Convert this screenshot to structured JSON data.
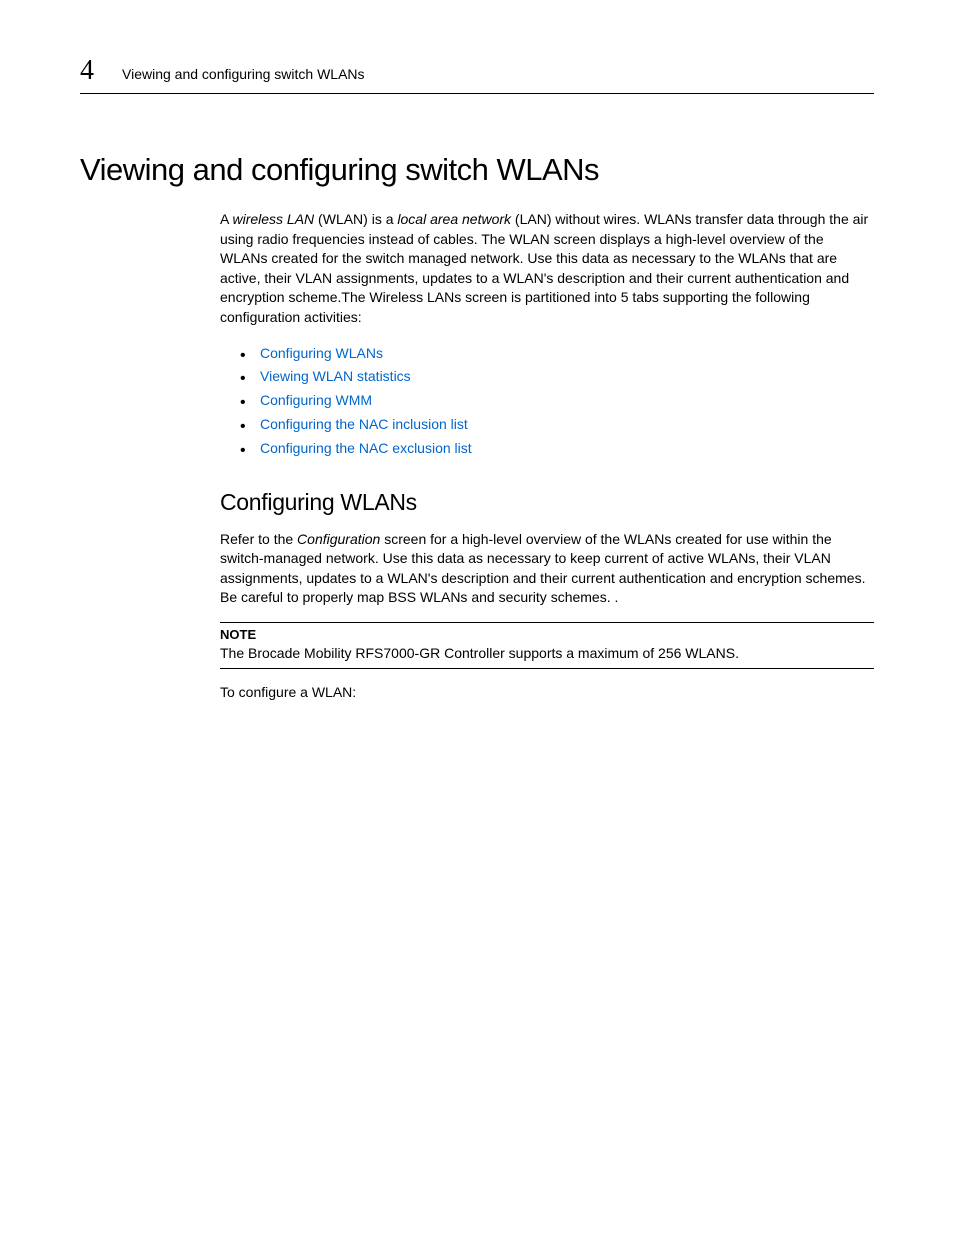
{
  "header": {
    "chapter_number": "4",
    "running_title": "Viewing and configuring switch WLANs"
  },
  "main_heading": "Viewing and configuring switch WLANs",
  "intro": {
    "seg1": "A ",
    "italic1": "wireless LAN",
    "seg2": " (WLAN) is a ",
    "italic2": "local area network",
    "seg3": " (LAN) without wires. WLANs transfer data through the air using radio frequencies instead of cables. The WLAN screen displays a high-level overview of the WLANs created for the switch managed network. Use this data as necessary to the WLANs that are active, their VLAN assignments, updates to a WLAN's description and their current authentication and encryption scheme.The Wireless LANs screen is partitioned into 5 tabs supporting the following configuration activities:"
  },
  "bullets": [
    "Configuring WLANs",
    "Viewing WLAN statistics",
    "Configuring WMM",
    "Configuring the NAC inclusion list",
    "Configuring the NAC exclusion list"
  ],
  "section": {
    "heading": "Configuring WLANs",
    "para_seg1": "Refer to the ",
    "para_italic": "Configuration",
    "para_seg2": " screen for a high-level overview of the WLANs created for use within the switch-managed network. Use this data as necessary to keep current of active WLANs, their VLAN assignments, updates to a WLAN's description and their current authentication and encryption schemes. Be careful to properly map BSS WLANs and security schemes. ."
  },
  "note": {
    "label": "NOTE",
    "text": "The Brocade Mobility RFS7000-GR Controller supports a maximum of 256 WLANS."
  },
  "closing": "To configure a WLAN:"
}
